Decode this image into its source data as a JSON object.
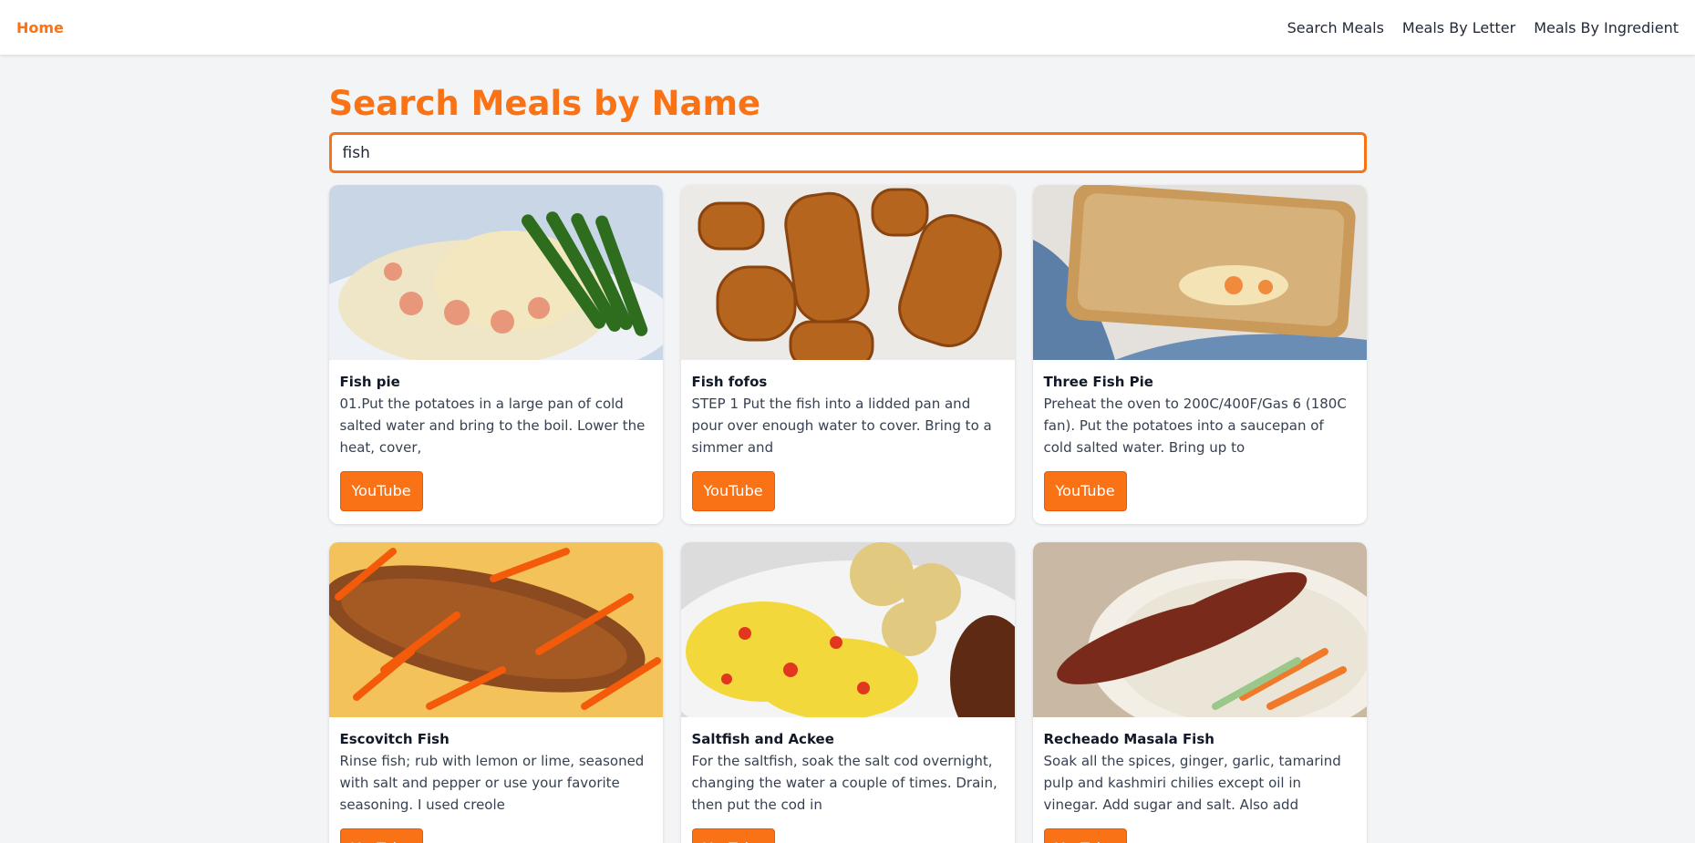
{
  "header": {
    "home_label": "Home",
    "nav": [
      "Search Meals",
      "Meals By Letter",
      "Meals By Ingredient"
    ]
  },
  "main": {
    "title": "Search Meals by Name",
    "search_value": "fish"
  },
  "meals": [
    {
      "name": "Fish pie",
      "description": "01.Put the potatoes in a large pan of cold salted water and bring to the boil. Lower the heat, cover,",
      "button": "YouTube"
    },
    {
      "name": "Fish fofos",
      "description": "STEP 1 Put the fish into a lidded pan and pour over enough water to cover. Bring to a simmer and",
      "button": "YouTube"
    },
    {
      "name": "Three Fish Pie",
      "description": "Preheat the oven to 200C/400F/Gas 6 (180C fan). Put the potatoes into a saucepan of cold salted water. Bring up to",
      "button": "YouTube"
    },
    {
      "name": "Escovitch Fish",
      "description": "Rinse fish; rub with lemon or lime, seasoned with salt and pepper or use your favorite seasoning. I used creole",
      "button": "YouTube"
    },
    {
      "name": "Saltfish and Ackee",
      "description": "For the saltfish, soak the salt cod overnight, changing the water a couple of times. Drain, then put the cod in",
      "button": "YouTube"
    },
    {
      "name": "Recheado Masala Fish",
      "description": "Soak all the spices, ginger, garlic, tamarind pulp and kashmiri chilies except oil in vinegar. Add sugar and salt. Also add turmeric",
      "button": "YouTube"
    }
  ],
  "colors": {
    "accent": "#f97316",
    "background": "#f3f4f6"
  }
}
